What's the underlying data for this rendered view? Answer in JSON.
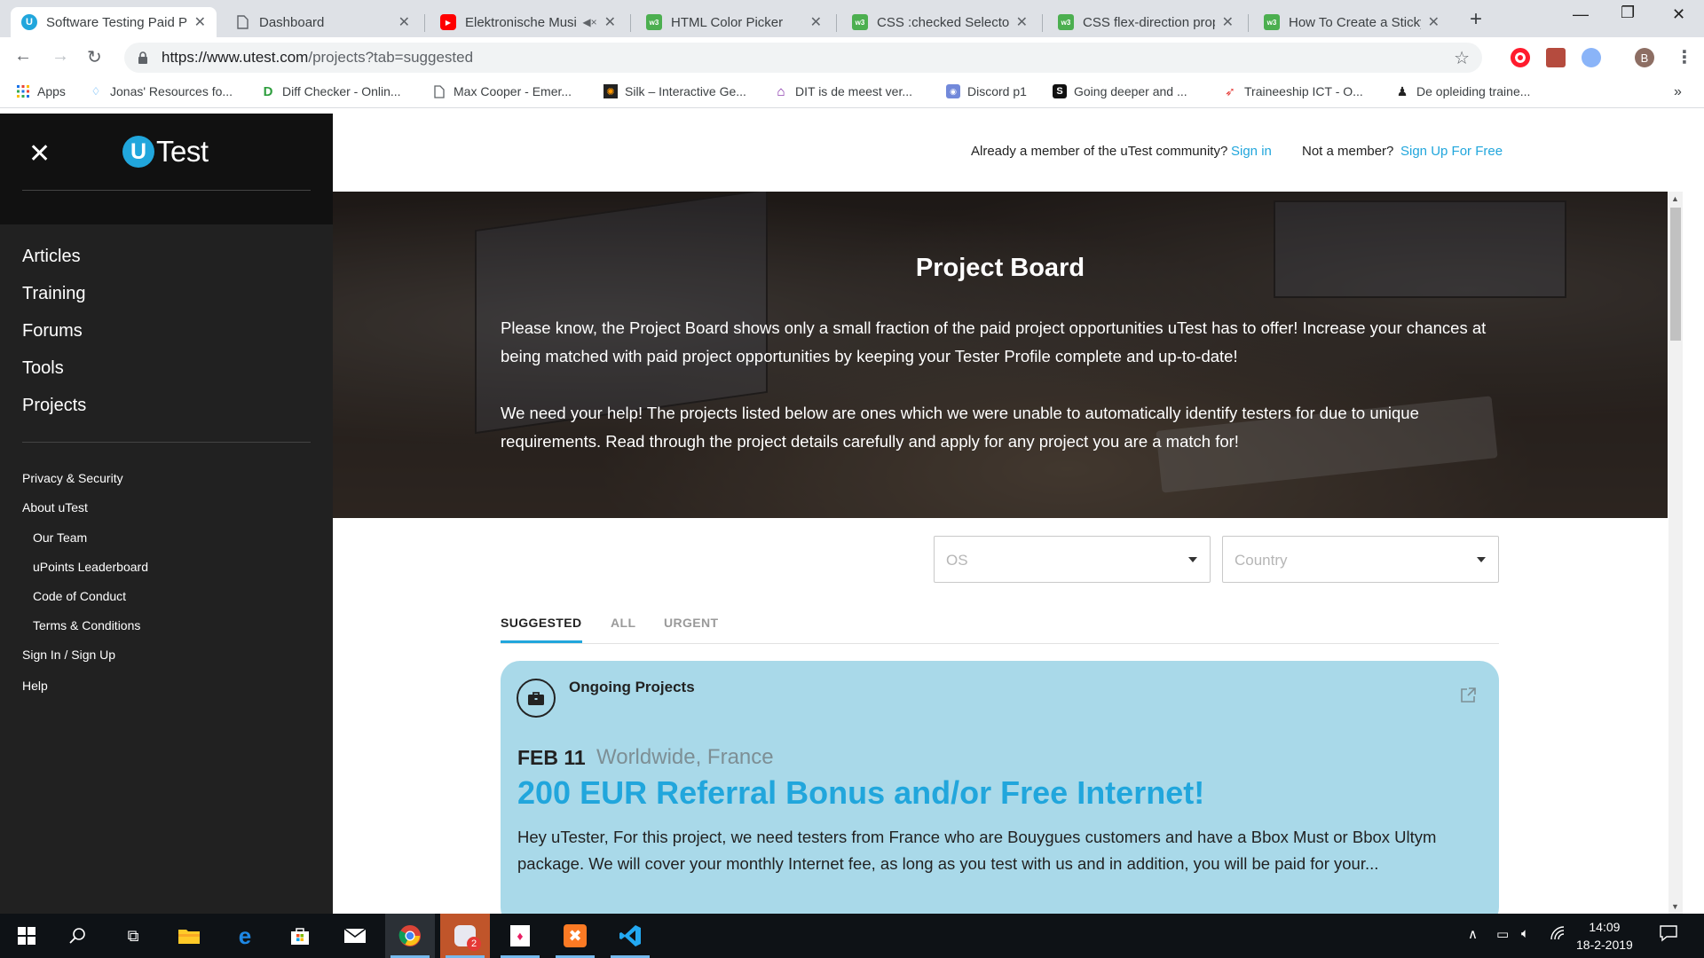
{
  "browser": {
    "tabs": [
      {
        "title": "Software Testing Paid P",
        "favicon": "utest-icon",
        "color": "#21a6dc",
        "active": true
      },
      {
        "title": "Dashboard",
        "favicon": "page-icon",
        "color": "#5f6368"
      },
      {
        "title": "Elektronische Musi",
        "favicon": "youtube-icon",
        "color": "#ff0000"
      },
      {
        "title": "HTML Color Picker",
        "favicon": "w3schools-icon",
        "color": "#4caf50"
      },
      {
        "title": "CSS :checked Selector",
        "favicon": "w3schools-icon",
        "color": "#4caf50"
      },
      {
        "title": "CSS flex-direction prop",
        "favicon": "w3schools-icon",
        "color": "#4caf50"
      },
      {
        "title": "How To Create a Sticky",
        "favicon": "w3schools-icon",
        "color": "#4caf50"
      }
    ],
    "url_main": "https://www.utest.com",
    "url_rest": "/projects?tab=suggested",
    "profile_initial": "B",
    "bookmarks": [
      {
        "label": "Apps",
        "icon": "apps-grid-icon"
      },
      {
        "label": "Jonas' Resources fo...",
        "icon": "diamond-icon"
      },
      {
        "label": "Diff Checker - Onlin...",
        "icon": "diffchecker-icon"
      },
      {
        "label": "Max Cooper - Emer...",
        "icon": "page-icon"
      },
      {
        "label": "Silk – Interactive Ge...",
        "icon": "silk-icon"
      },
      {
        "label": "DIT is de meest ver...",
        "icon": "house-icon"
      },
      {
        "label": "Discord p1",
        "icon": "discord-icon"
      },
      {
        "label": "Going deeper and ...",
        "icon": "s-icon"
      },
      {
        "label": "Traineeship ICT - O...",
        "icon": "bird-icon"
      },
      {
        "label": "De opleiding traine...",
        "icon": "person-icon"
      }
    ]
  },
  "sidebar": {
    "logo_letter": "U",
    "logo_text": "Test",
    "main_nav": [
      "Articles",
      "Training",
      "Forums",
      "Tools",
      "Projects"
    ],
    "footer_links": [
      {
        "label": "Privacy & Security",
        "indent": false
      },
      {
        "label": "About uTest",
        "indent": false
      },
      {
        "label": "Our Team",
        "indent": true
      },
      {
        "label": "uPoints Leaderboard",
        "indent": true
      },
      {
        "label": "Code of Conduct",
        "indent": true
      },
      {
        "label": "Terms & Conditions",
        "indent": true
      },
      {
        "label": "Sign In / Sign Up",
        "indent": false
      },
      {
        "label": "Help",
        "indent": false
      }
    ]
  },
  "topbar": {
    "member_text": "Already a member of the uTest community?",
    "sign_in": "Sign in",
    "not_member_text": "Not a member?",
    "sign_up": "Sign Up For Free"
  },
  "hero": {
    "title": "Project Board",
    "paragraph1": "Please know, the Project Board shows only a small fraction of the paid project opportunities uTest has to offer! Increase your chances at being matched with paid project opportunities by keeping your Tester Profile complete and up-to-date!",
    "paragraph2": "We need your help! The projects listed below are ones which we were unable to automatically identify testers for due to unique requirements. Read through the project details carefully and apply for any project you are a match for!"
  },
  "filters": {
    "os_placeholder": "OS",
    "country_placeholder": "Country"
  },
  "project_tabs": [
    "SUGGESTED",
    "ALL",
    "URGENT"
  ],
  "active_tab": "SUGGESTED",
  "project_card": {
    "type": "Ongoing Projects",
    "date": "FEB 11",
    "location": "Worldwide, France",
    "title": "200 EUR Referral Bonus and/or Free Internet!",
    "description": "Hey uTester,  For this project, we need testers from France who are Bouygues customers and have a Bbox Must or Bbox Ultym package. We will cover your monthly Internet fee, as long as you test with us and in addition, you will be paid for your..."
  },
  "taskbar": {
    "time": "14:09",
    "date": "18-2-2019",
    "badge_count": "2"
  },
  "colors": {
    "accent": "#21a6dc",
    "sidebar_bg": "#212121",
    "card_bg": "#a9d9e9"
  }
}
